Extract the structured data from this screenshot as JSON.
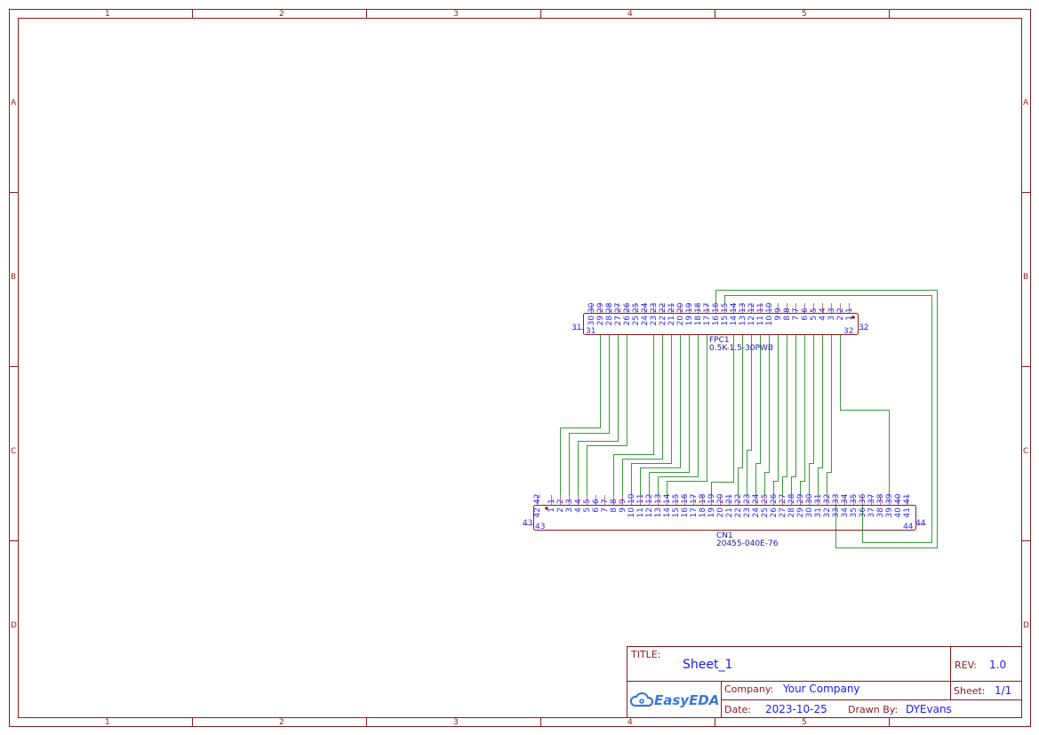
{
  "frame": {
    "columns": [
      "1",
      "2",
      "3",
      "4",
      "5"
    ],
    "rows": [
      "A",
      "B",
      "C",
      "D"
    ]
  },
  "colors": {
    "frame": "#8b1a1a",
    "pin_text": "#2a2aff",
    "wire": "#3a9a3a",
    "title_values": "#1a1aff"
  },
  "fpc1": {
    "designator": "FPC1",
    "part": "0.5K-1.5-30PWB",
    "pins": [
      "1",
      "2",
      "3",
      "4",
      "5",
      "6",
      "7",
      "8",
      "9",
      "10",
      "11",
      "12",
      "13",
      "14",
      "15",
      "16",
      "17",
      "18",
      "19",
      "20",
      "21",
      "22",
      "23",
      "24",
      "25",
      "26",
      "27",
      "28",
      "29",
      "30"
    ],
    "left_pin": "31",
    "right_pin": "32"
  },
  "cn1": {
    "designator": "CN1",
    "part": "20455-040E-76",
    "pins": [
      "1",
      "2",
      "3",
      "4",
      "5",
      "6",
      "7",
      "8",
      "9",
      "10",
      "11",
      "12",
      "13",
      "14",
      "15",
      "16",
      "17",
      "18",
      "19",
      "20",
      "21",
      "22",
      "23",
      "24",
      "25",
      "26",
      "27",
      "28",
      "29",
      "30",
      "31",
      "32",
      "33",
      "34",
      "35",
      "36",
      "37",
      "38",
      "39",
      "40",
      "41"
    ],
    "top_left_pin": "42",
    "left_pin": "43",
    "right_pin": "44"
  },
  "nets": [
    {
      "fpc": 29,
      "cn": 2
    },
    {
      "fpc": 28,
      "cn": 3
    },
    {
      "fpc": 27,
      "cn": 4
    },
    {
      "fpc": 26,
      "cn": 5
    },
    {
      "fpc": 23,
      "cn": 8
    },
    {
      "fpc": 22,
      "cn": 9
    },
    {
      "fpc": 21,
      "cn": 10
    },
    {
      "fpc": 20,
      "cn": 11
    },
    {
      "fpc": 19,
      "cn": 12
    },
    {
      "fpc": 18,
      "cn": 13
    },
    {
      "fpc": 17,
      "cn": 14
    },
    {
      "fpc": 14,
      "cn": 19
    },
    {
      "fpc": 13,
      "cn": 22
    },
    {
      "fpc": 12,
      "cn": 23
    },
    {
      "fpc": 11,
      "cn": 24
    },
    {
      "fpc": 10,
      "cn": 25
    },
    {
      "fpc": 9,
      "cn": 26
    },
    {
      "fpc": 8,
      "cn": 27
    },
    {
      "fpc": 7,
      "cn": 28
    },
    {
      "fpc": 6,
      "cn": 29
    },
    {
      "fpc": 5,
      "cn": 30
    },
    {
      "fpc": 4,
      "cn": 31
    },
    {
      "fpc": 3,
      "cn": 32
    },
    {
      "fpc": 2,
      "cn": 39
    },
    {
      "fpc": 16,
      "cn": 33
    },
    {
      "fpc": 15,
      "cn": 36
    }
  ],
  "title_block": {
    "title_label": "TITLE:",
    "title": "Sheet_1",
    "rev_label": "REV:",
    "rev": "1.0",
    "company_label": "Company:",
    "company": "Your Company",
    "sheet_label": "Sheet:",
    "sheet": "1/1",
    "date_label": "Date:",
    "date": "2023-10-25",
    "drawn_by_label": "Drawn By:",
    "drawn_by": "DYEvans",
    "logo_text": "EasyEDA"
  }
}
